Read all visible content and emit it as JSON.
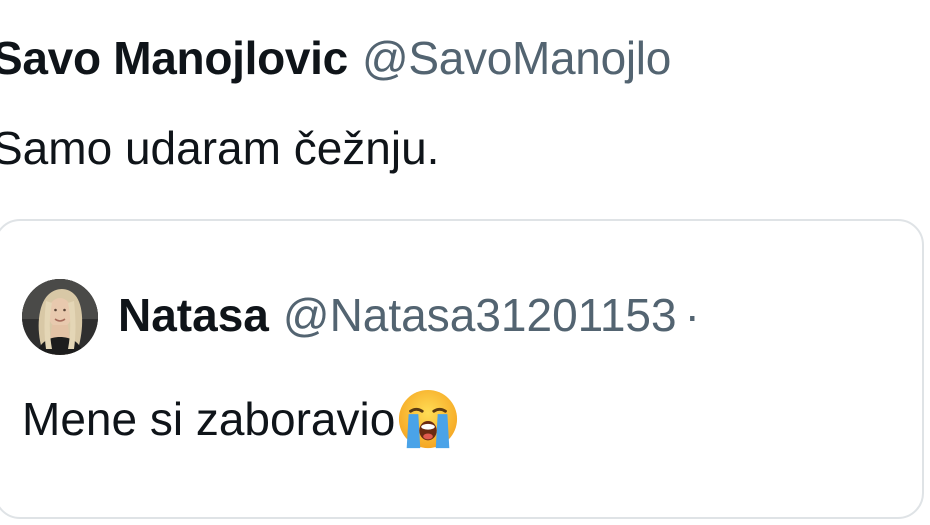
{
  "tweet": {
    "display_name": "Savo Manojlovic",
    "handle": "@SavoManojlo",
    "text": "Samo udaram čežnju."
  },
  "quoted_tweet": {
    "display_name": "Natasa",
    "handle": "@Natasa31201153",
    "separator": "·",
    "text": "Mene si zaboravio",
    "emoji": "loudly-crying-face-emoji",
    "avatar": "profile-photo-blonde-woman"
  },
  "colors": {
    "text_primary": "#0f1419",
    "text_secondary": "#536471",
    "border": "#dfe3e6",
    "background": "#ffffff"
  }
}
